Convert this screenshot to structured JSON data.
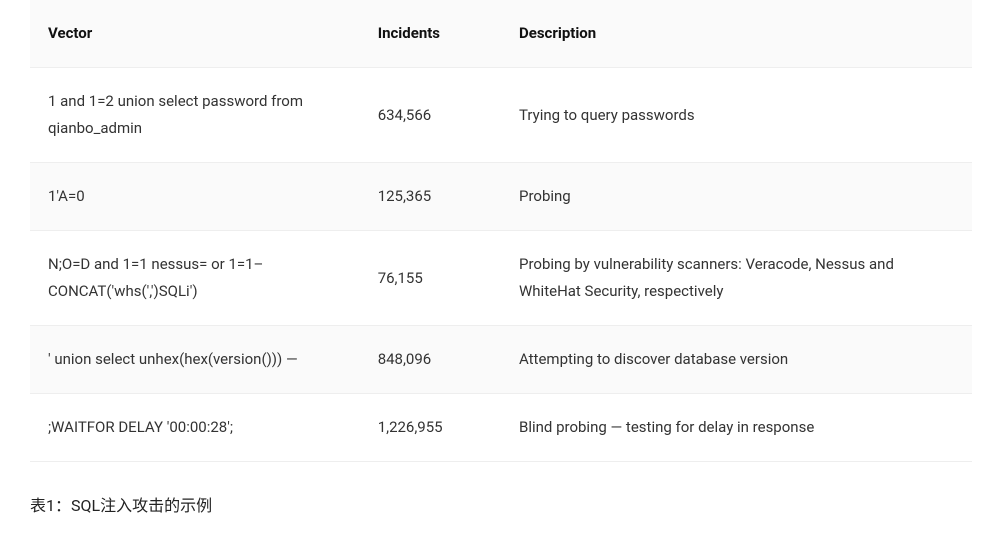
{
  "table": {
    "headers": {
      "vector": "Vector",
      "incidents": "Incidents",
      "description": "Description"
    },
    "rows": [
      {
        "vector": "1 and 1=2 union select password from qianbo_admin",
        "incidents": "634,566",
        "description": "Trying to query passwords"
      },
      {
        "vector": "1'A=0",
        "incidents": "125,365",
        "description": "Probing"
      },
      {
        "vector": "N;O=D and 1=1 nessus= or 1=1– CONCAT('whs(',')SQLi')",
        "incidents": "76,155",
        "description": "Probing by vulnerability scanners: Veracode, Nessus and WhiteHat Security, respectively"
      },
      {
        "vector": "' union select unhex(hex(version())) —",
        "incidents": "848,096",
        "description": "Attempting to discover database version"
      },
      {
        "vector": ";WAITFOR DELAY '00:00:28';",
        "incidents": "1,226,955",
        "description": "Blind probing — testing for delay in response"
      }
    ]
  },
  "caption": "表1：SQL注入攻击的示例"
}
